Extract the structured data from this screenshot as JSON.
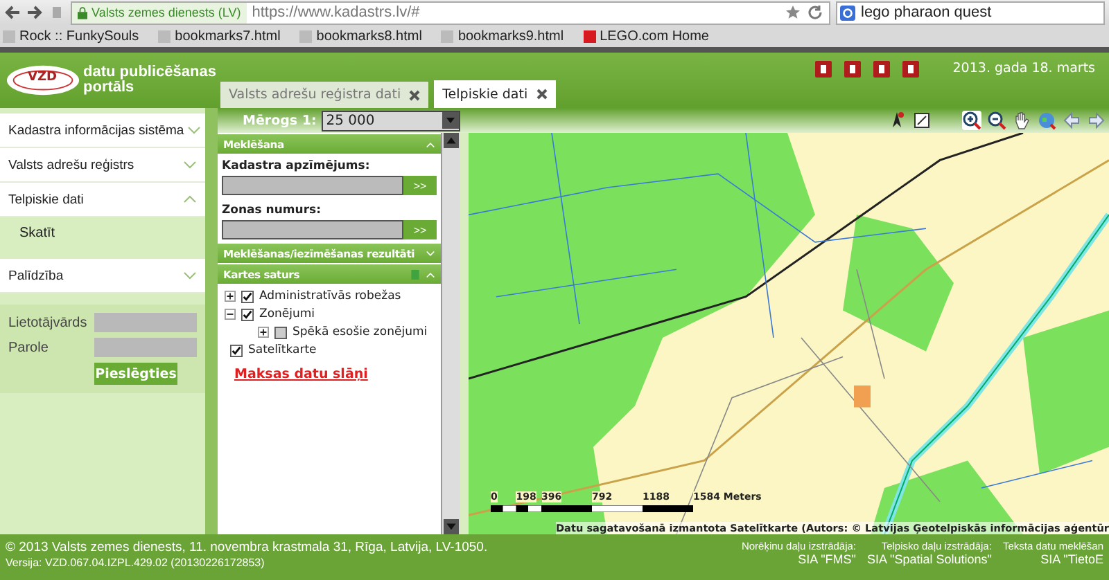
{
  "browser": {
    "site_identity": "Valsts zemes dienests (LV)",
    "url": "https://www.kadastrs.lv/#",
    "search_value": "lego pharaon quest",
    "bookmarks": [
      "Rock :: FunkySouls",
      "bookmarks7.html",
      "bookmarks8.html",
      "bookmarks9.html",
      "LEGO.com Home"
    ]
  },
  "header": {
    "logo": "VZD",
    "title": "datu publicēšanas portāls",
    "date": "2013. gada 18. marts"
  },
  "tabs": [
    {
      "label": "Valsts adrešu reģistra dati",
      "selected": false
    },
    {
      "label": "Telpiskie dati",
      "selected": true
    }
  ],
  "scale": {
    "label": "Mērogs 1:",
    "value": "25 000"
  },
  "sidebar": {
    "groups": [
      [
        {
          "label": "Kadastra informācijas sistēma",
          "expanded": false
        },
        {
          "label": "Valsts adrešu reģistrs",
          "expanded": false
        },
        {
          "label": "Telpiskie dati",
          "expanded": true,
          "children": [
            "Skatīt"
          ]
        }
      ],
      [
        {
          "label": "Palīdzība",
          "expanded": false
        }
      ]
    ],
    "login": {
      "username_label": "Lietotājvārds",
      "password_label": "Parole",
      "button": "Pieslēgties"
    }
  },
  "panel": {
    "search": {
      "title": "Meklēšana",
      "fields": [
        {
          "label": "Kadastra apzīmējums:",
          "button": ">>"
        },
        {
          "label": "Zonas numurs:",
          "button": ">>"
        }
      ]
    },
    "results": {
      "title": "Meklēšanas/iezīmēšanas rezultāti"
    },
    "contents": {
      "title": "Kartes saturs",
      "layers": [
        {
          "label": "Administratīvās robežas",
          "kind": "group",
          "checked": true,
          "expanded": false
        },
        {
          "label": "Zonējumi",
          "kind": "group",
          "checked": true,
          "expanded": true,
          "children": [
            {
              "label": "Spēkā esošie zonējumi",
              "kind": "group",
              "checked": false,
              "expanded": false
            }
          ]
        },
        {
          "label": "Satelītkarte",
          "kind": "layer",
          "checked": true
        }
      ]
    },
    "link": "Maksas datu slāņi"
  },
  "map": {
    "scale_labels": [
      "0",
      "198",
      "396",
      "792",
      "1188",
      "1584 Meters"
    ],
    "attribution": "Datu sagatavošanā izmantota Satelītkarte (Autors: © Latvijas Ģeotelpiskās informācijas aģentūr"
  },
  "footer": {
    "copyright": "© 2013 Valsts zemes dienests, 11. novembra krastmala 31, Rīga, Latvija, LV-1050.",
    "version": "Versija: VZD.067.04.IZPL.429.02 (20130226172853)",
    "credits": [
      {
        "label": "Norēķinu daļu izstrādāja:",
        "value": "SIA \"FMS\""
      },
      {
        "label": "Telpisko daļu izstrādāja:",
        "value": "SIA \"Spatial Solutions\""
      },
      {
        "label": "Teksta datu meklēšan",
        "value": "SIA \"TietoE"
      }
    ]
  }
}
